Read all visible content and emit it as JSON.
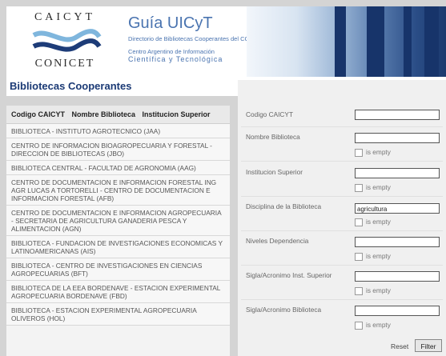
{
  "header": {
    "logo_top": "CAICYT",
    "logo_bottom": "CONICET",
    "title": "Guía UICyT",
    "subtitle1": "Directorio de Bibliotecas Cooperantes del CCPP y del CCLC",
    "subtitle2": "Centro Argentino de Información",
    "subtitle3": "Científica y Tecnológica"
  },
  "section": {
    "title": "Bibliotecas Cooperantes"
  },
  "list": {
    "columns": [
      "Codigo CAICYT",
      "Nombre Biblioteca",
      "Institucion Superior"
    ],
    "rows": [
      "BIBLIOTECA - INSTITUTO AGROTECNICO (JAA)",
      "CENTRO DE INFORMACION BIOAGROPECUARIA Y FORESTAL - DIRECCION DE BIBLIOTECAS (JBO)",
      "BIBLIOTECA CENTRAL - FACULTAD DE AGRONOMIA (AAG)",
      "CENTRO DE DOCUMENTACION E INFORMACION FORESTAL ING AGR LUCAS A TORTORELLI - CENTRO DE DOCUMENTACION E INFORMACION FORESTAL (AFB)",
      "CENTRO DE DOCUMENTACION E INFORMACION AGROPECUARIA - SECRETARIA DE AGRICULTURA GANADERIA PESCA Y ALIMENTACION (AGN)",
      "BIBLIOTECA - FUNDACION DE INVESTIGACIONES ECONOMICAS Y LATINOAMERICANAS (AIS)",
      "BIBLIOTECA - CENTRO DE INVESTIGACIONES EN CIENCIAS AGROPECUARIAS (BFT)",
      "BIBLIOTECA DE LA EEA BORDENAVE - ESTACION EXPERIMENTAL AGROPECUARIA BORDENAVE (FBD)",
      "BIBLIOTECA - ESTACION EXPERIMENTAL AGROPECUARIA OLIVEROS (HOL)"
    ]
  },
  "filters": {
    "codigo_label": "Codigo CAICYT",
    "codigo_value": "",
    "nombre_label": "Nombre Biblioteca",
    "nombre_value": "",
    "institucion_label": "Institucion Superior",
    "institucion_value": "",
    "disciplina_label": "Disciplina de la Biblioteca",
    "disciplina_value": "agricultura",
    "niveles_label": "Niveles Dependencia",
    "niveles_value": "",
    "sigla_inst_label": "Sigla/Acronimo Inst. Superior",
    "sigla_inst_value": "",
    "sigla_bib_label": "Sigla/Acronimo Biblioteca",
    "sigla_bib_value": "",
    "is_empty_label": "is empty",
    "reset_label": "Reset",
    "filter_label": "Filter"
  }
}
